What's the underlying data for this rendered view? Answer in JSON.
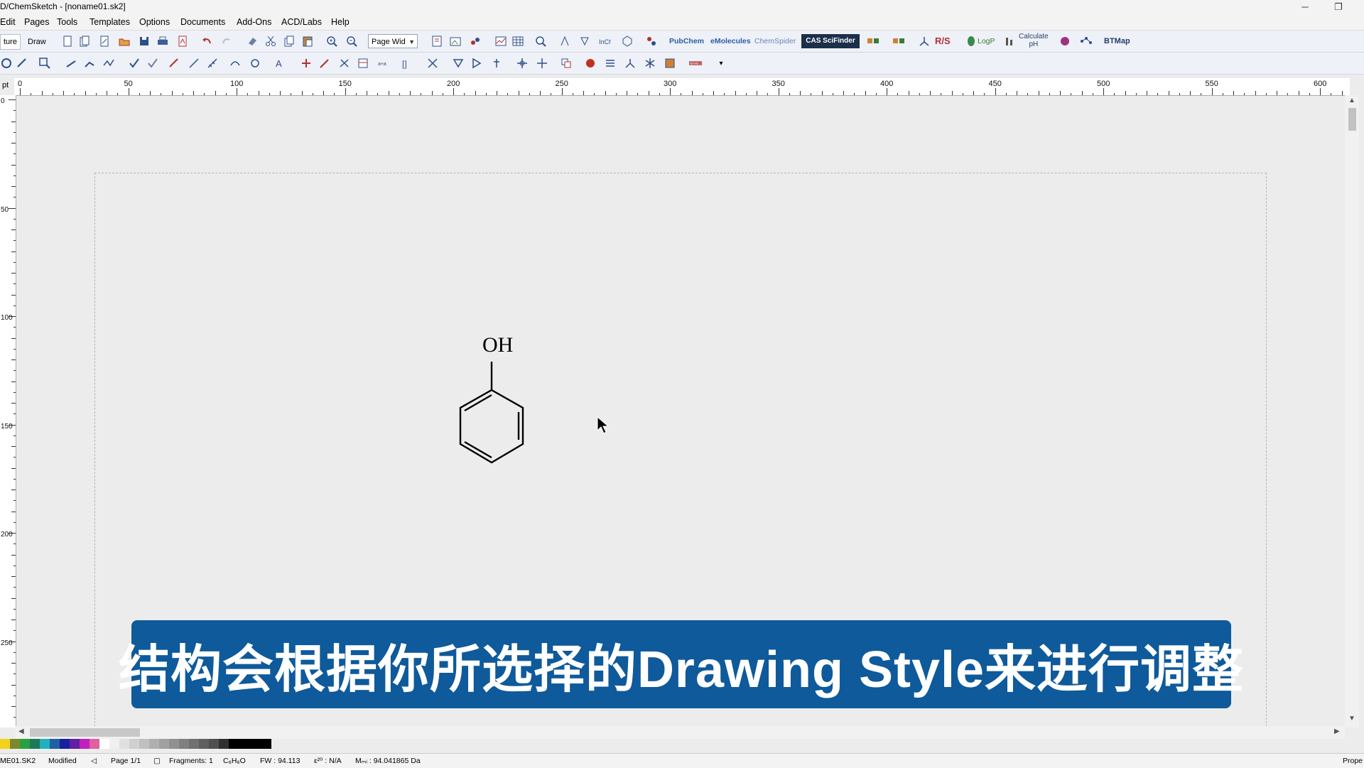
{
  "window": {
    "title": "D/ChemSketch - [noname01.sk2]",
    "minimize": "─",
    "restore": "❐"
  },
  "menu": [
    "Edit",
    "Pages",
    "Tools",
    "Templates",
    "Options",
    "Documents",
    "Add-Ons",
    "ACD/Labs",
    "Help"
  ],
  "toolbar": {
    "structure_tab": "ture",
    "draw_tab": "Draw",
    "zoom_combo": "Page Wid",
    "pubchem": "PubChem",
    "emolecules": "eMolecules",
    "chemspider": "ChemSpider",
    "cas": "CAS SciFinder",
    "rs": "R/S",
    "logp": "LogP",
    "calculate": "Calculate",
    "ph": "pH",
    "btmap": "BTMap"
  },
  "ruler": {
    "unit": "pt",
    "h_labels": [
      "0",
      "50",
      "100",
      "150",
      "200",
      "250",
      "300",
      "350",
      "400",
      "450",
      "500",
      "550",
      "600"
    ],
    "v_labels": [
      "0",
      "50",
      "100",
      "150",
      "200",
      "250"
    ]
  },
  "molecule": {
    "label": "OH"
  },
  "status": {
    "file": "ME01.SK2",
    "state": "Modified",
    "page": "Page 1/1",
    "fragments": "Fragments: 1",
    "formula": "C₆H₆O",
    "fw": "FW : 94.113",
    "epsilon": "ε²⁰ : N/A",
    "mass": "Mₘᵢ : 94.041865 Da",
    "props": "Prope"
  },
  "subtitle": "结构会根据你所选择的Drawing Style来进行调整"
}
